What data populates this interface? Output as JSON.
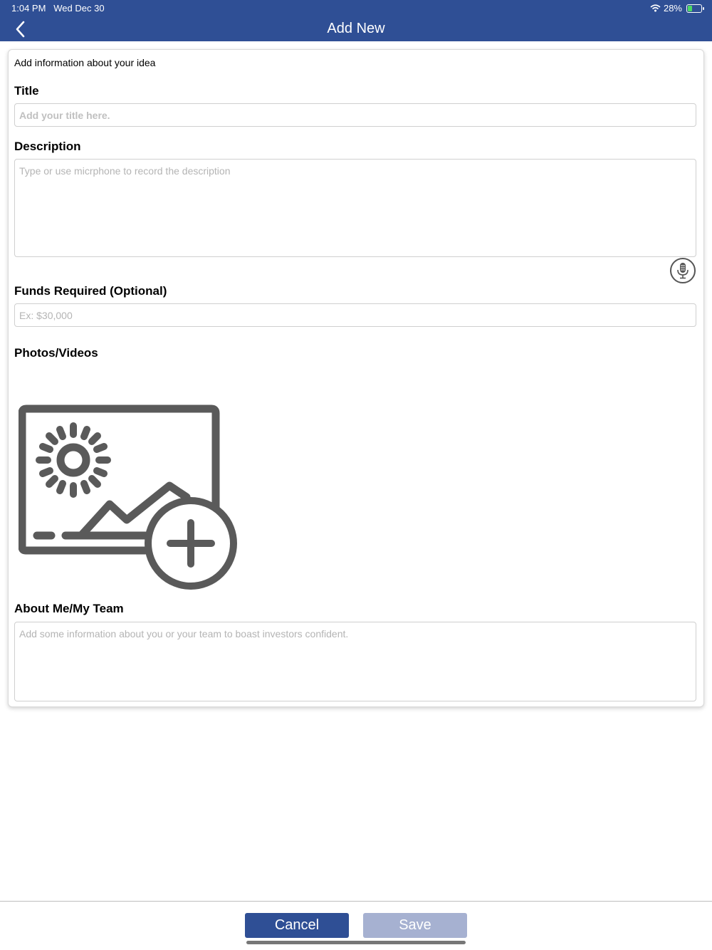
{
  "status_bar": {
    "time": "1:04 PM",
    "date": "Wed Dec 30",
    "battery": "28%",
    "wifi_icon": "wifi-icon",
    "battery_icon": "battery-charging-icon"
  },
  "nav": {
    "title": "Add New",
    "back_icon": "chevron-left-icon",
    "background": "#2f4f95"
  },
  "form": {
    "intro": "Add information about your idea",
    "title_label": "Title",
    "title_placeholder": "Add your title here.",
    "title_value": "",
    "description_label": "Description",
    "description_placeholder": "Type or use micrphone to record the description",
    "description_value": "",
    "mic_icon": "microphone-icon",
    "funds_label": "Funds Required (Optional)",
    "funds_placeholder": "Ex: $30,000",
    "funds_value": "",
    "photos_label": "Photos/Videos",
    "photo_add_icon": "add-photo-icon",
    "about_label": "About Me/My Team",
    "about_placeholder": "Add some information about you or your team to boast investors confident.",
    "about_value": ""
  },
  "actions": {
    "cancel_label": "Cancel",
    "save_label": "Save",
    "cancel_color": "#2f4f95",
    "save_color": "#a6b1d1"
  }
}
